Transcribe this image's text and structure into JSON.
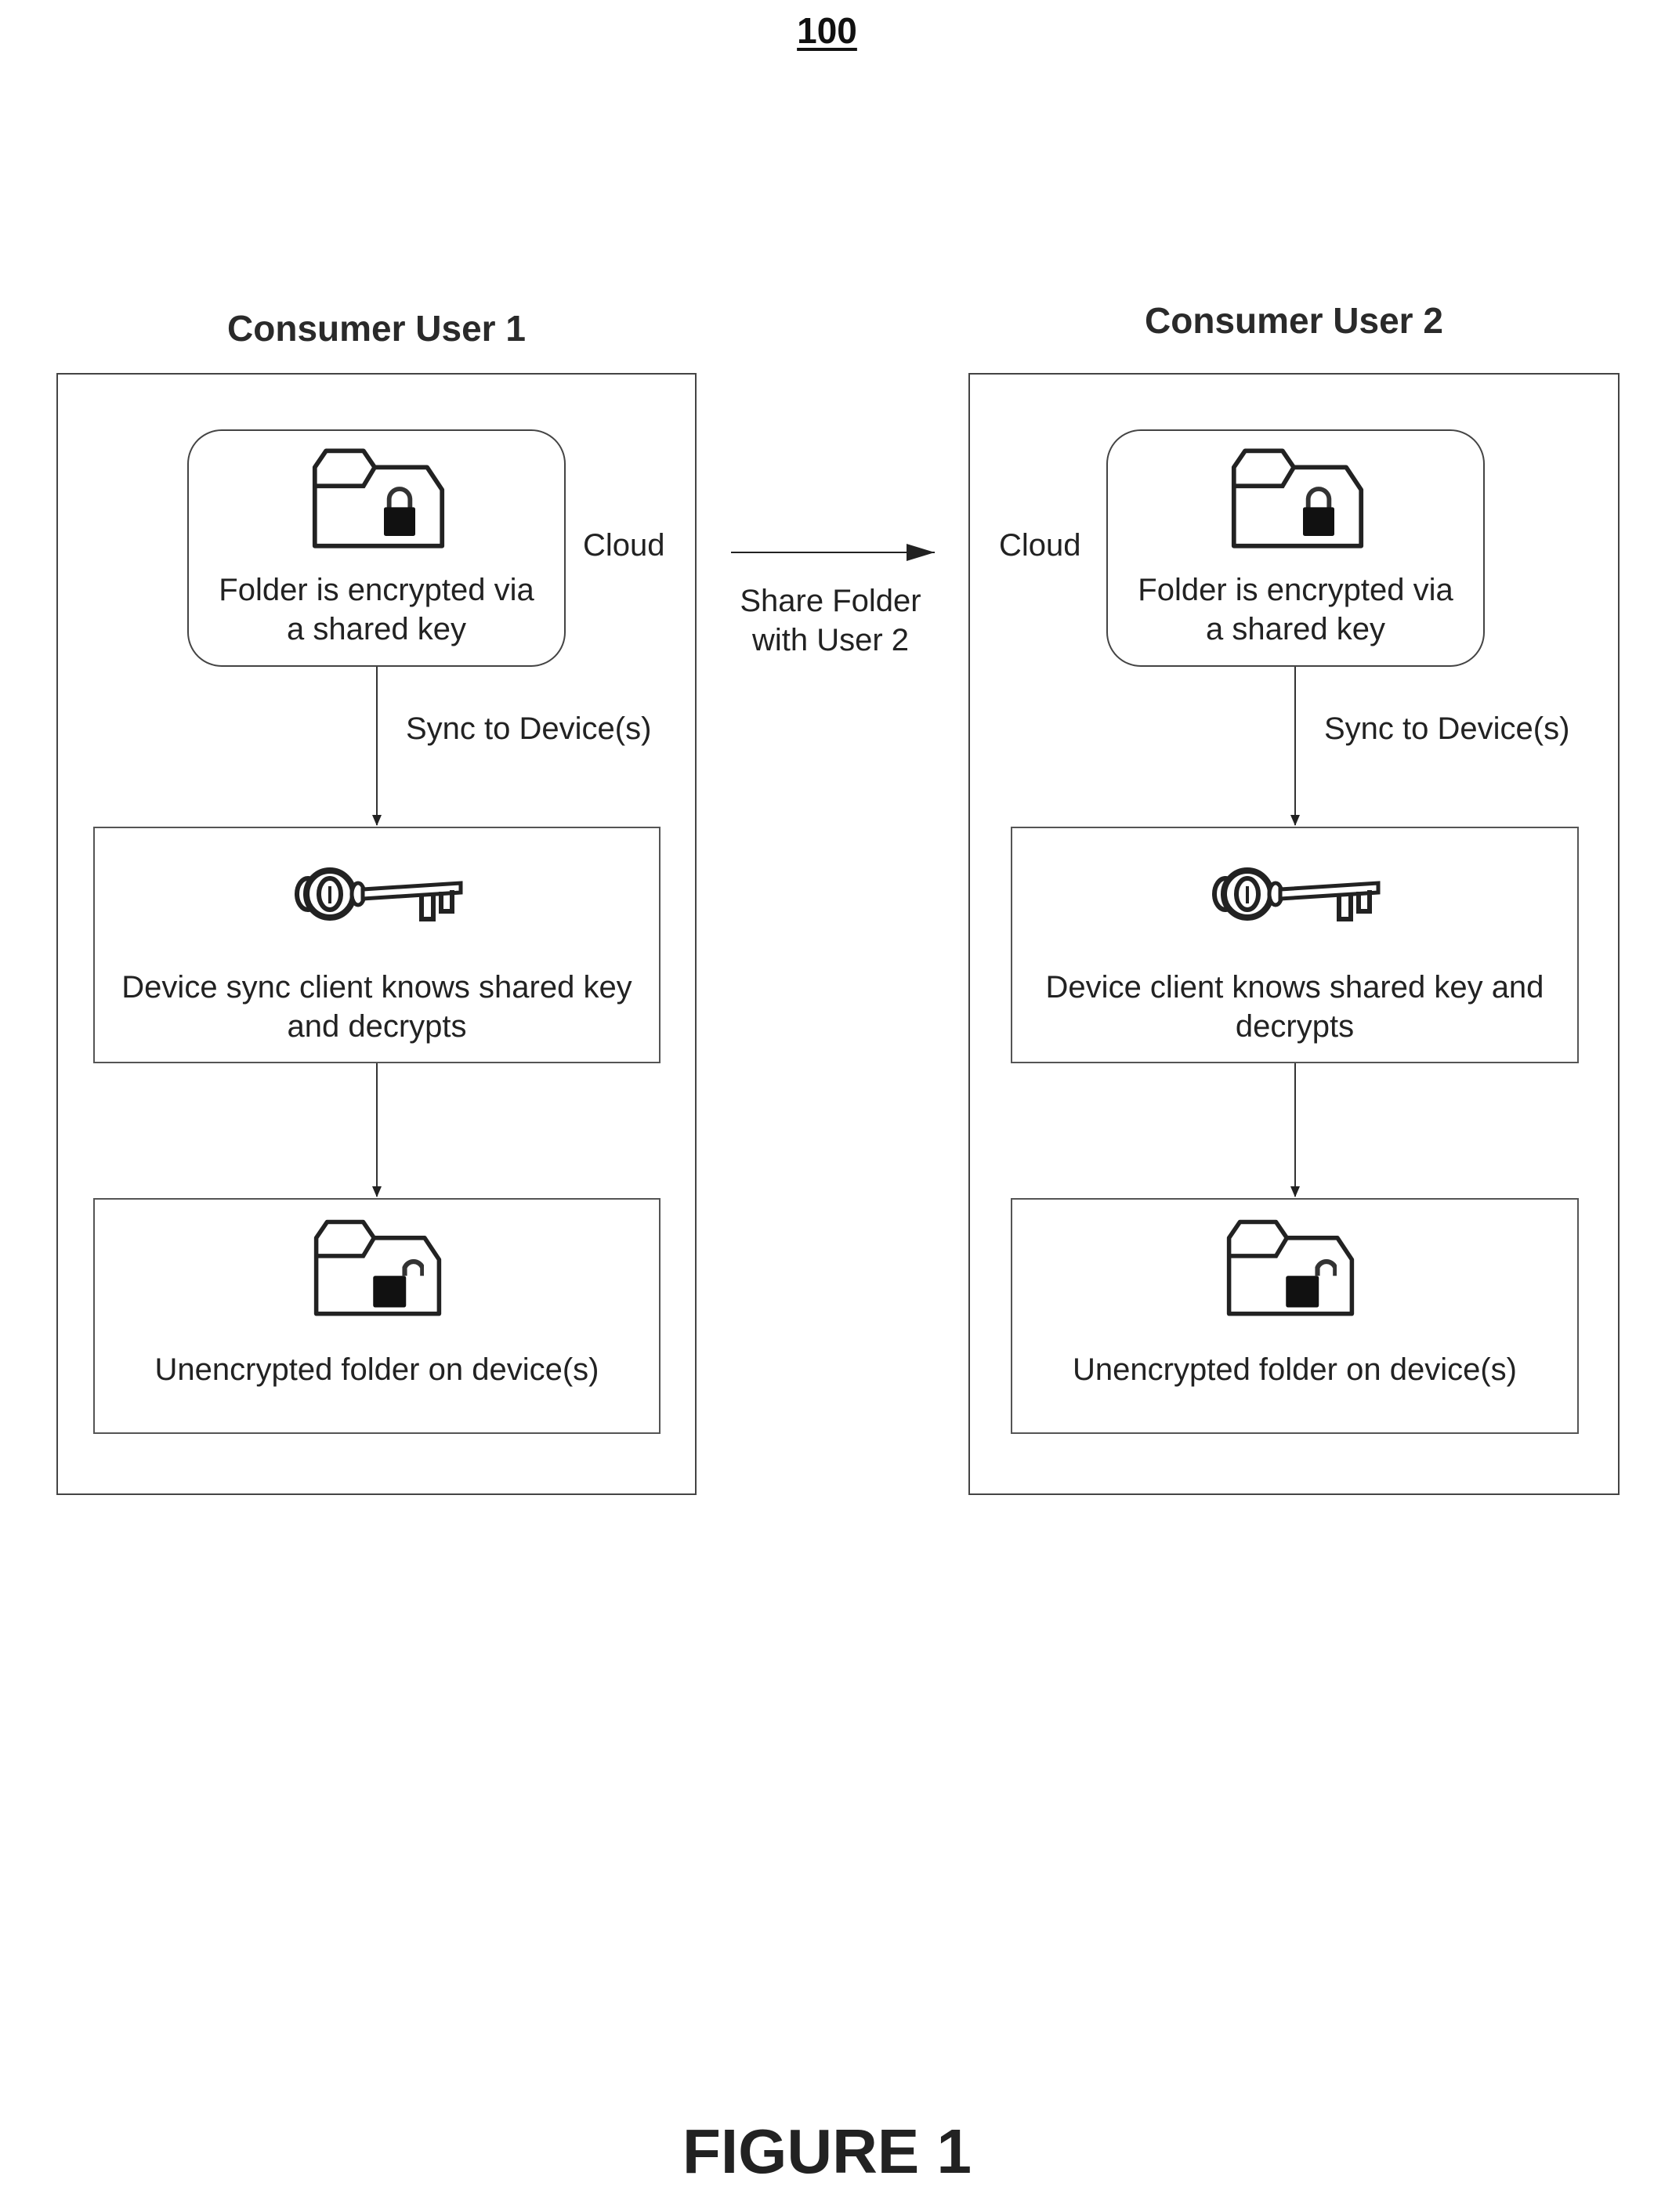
{
  "figure_number": "100",
  "figure_label": "FIGURE 1",
  "share_arrow": {
    "label_line1": "Share Folder",
    "label_line2": "with User 2"
  },
  "users": [
    {
      "title": "Consumer User 1",
      "cloud_label": "Cloud",
      "cloud_box": {
        "icon": "locked-folder-icon",
        "line1": "Folder is encrypted via",
        "line2": "a shared key"
      },
      "sync_label": "Sync to Device(s)",
      "device_box": {
        "icon": "key-icon",
        "line1": "Device sync client knows shared key",
        "line2": "and decrypts"
      },
      "unencrypted_box": {
        "icon": "unlocked-folder-icon",
        "line1": "Unencrypted folder on device(s)"
      }
    },
    {
      "title": "Consumer User 2",
      "cloud_label": "Cloud",
      "cloud_box": {
        "icon": "locked-folder-icon",
        "line1": "Folder is encrypted via",
        "line2": "a shared key"
      },
      "sync_label": "Sync to Device(s)",
      "device_box": {
        "icon": "key-icon",
        "line1": "Device client knows shared key and",
        "line2": "decrypts"
      },
      "unencrypted_box": {
        "icon": "unlocked-folder-icon",
        "line1": "Unencrypted folder on device(s)"
      }
    }
  ]
}
